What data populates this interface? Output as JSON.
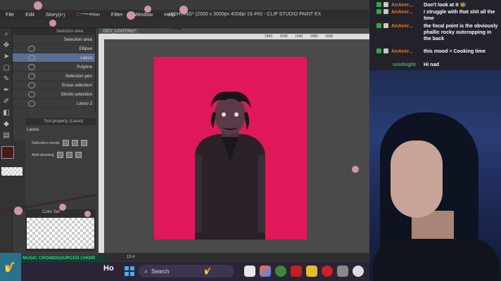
{
  "csp": {
    "menu": [
      "File",
      "Edit",
      "Story(P)",
      "Animation",
      "Filter",
      "Window",
      "Help"
    ],
    "window_title": "LIGHTING* (2500 x 3000px 400dpi 19.4%) - CLIP STUDIO PAINT EX",
    "doc_tab": "DEV_LIGHTING*",
    "subtool_header": "Selection area",
    "subtool_items": [
      "Selection area",
      "Ellipse",
      "Lasso",
      "Polyline",
      "Selection pen",
      "Erase selection",
      "Shrink selection",
      "Lasso 2"
    ],
    "selected_subtool": "Lasso",
    "tool_property_header": "Tool property (Lasso)",
    "tool_property_name": "Lasso",
    "selection_mode_label": "Selection mode",
    "anti_aliasing_label": "Anti-aliasing",
    "palette_header": "Color Set",
    "zoom_display": "19.4",
    "ruler_ticks": [
      "1460",
      "1540",
      "1560",
      "1580",
      "1600"
    ],
    "canvas_color": "#e0185a"
  },
  "chat": {
    "messages": [
      {
        "user": "AnAver...",
        "text": "Don't look at it 🐝"
      },
      {
        "user": "AnAver...",
        "text": "I struggle with that shit all the time"
      },
      {
        "user": "AnAver...",
        "text": "the focal point is the obviously phallic rocky outcropping in the back"
      },
      {
        "user": "AnAver...",
        "text": "this mood = Cooking time"
      },
      {
        "user": "nnidnight",
        "text": "Hi nad"
      }
    ]
  },
  "overlay": {
    "music_label": "MUSIC CROWDSOURCED CHOIR",
    "ho_text": "Ho"
  },
  "taskbar": {
    "search_placeholder": "Search"
  }
}
